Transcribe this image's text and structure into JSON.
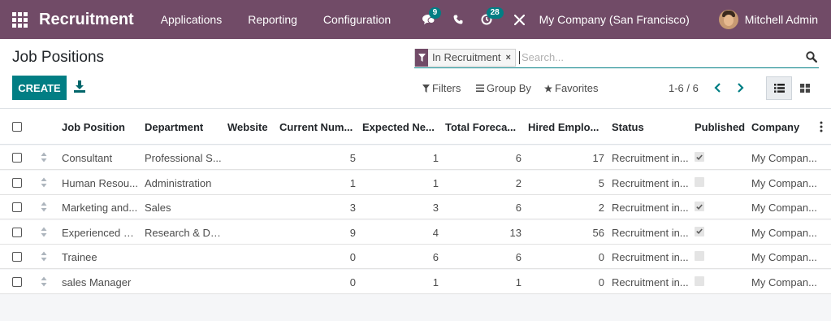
{
  "navbar": {
    "app_name": "Recruitment",
    "menu": [
      "Applications",
      "Reporting",
      "Configuration"
    ],
    "messages_badge": "9",
    "activities_badge": "28",
    "company": "My Company (San Francisco)",
    "user": "Mitchell Admin",
    "brand_color": "#714b67"
  },
  "control_panel": {
    "title": "Job Positions",
    "create_label": "CREATE",
    "search": {
      "facet": "In Recruitment",
      "placeholder": "Search..."
    },
    "filters_label": "Filters",
    "group_by_label": "Group By",
    "favorites_label": "Favorites",
    "pager": "1-6 / 6",
    "accent_color": "#017e84"
  },
  "table": {
    "columns": [
      "Job Position",
      "Department",
      "Website",
      "Current Num...",
      "Expected Ne...",
      "Total Foreca...",
      "Hired Emplo...",
      "Status",
      "Published",
      "Company"
    ],
    "rows": [
      {
        "job": "Consultant",
        "department": "Professional S...",
        "website": "",
        "current": "5",
        "expected": "1",
        "forecast": "6",
        "hired": "17",
        "status": "Recruitment in...",
        "published": true,
        "company": "My Compan..."
      },
      {
        "job": "Human Resou...",
        "department": "Administration",
        "website": "",
        "current": "1",
        "expected": "1",
        "forecast": "2",
        "hired": "5",
        "status": "Recruitment in...",
        "published": false,
        "company": "My Compan..."
      },
      {
        "job": "Marketing and...",
        "department": "Sales",
        "website": "",
        "current": "3",
        "expected": "3",
        "forecast": "6",
        "hired": "2",
        "status": "Recruitment in...",
        "published": true,
        "company": "My Compan..."
      },
      {
        "job": "Experienced D...",
        "department": "Research & De...",
        "website": "",
        "current": "9",
        "expected": "4",
        "forecast": "13",
        "hired": "56",
        "status": "Recruitment in...",
        "published": true,
        "company": "My Compan..."
      },
      {
        "job": "Trainee",
        "department": "",
        "website": "",
        "current": "0",
        "expected": "6",
        "forecast": "6",
        "hired": "0",
        "status": "Recruitment in...",
        "published": false,
        "company": "My Compan..."
      },
      {
        "job": "sales Manager",
        "department": "",
        "website": "",
        "current": "0",
        "expected": "1",
        "forecast": "1",
        "hired": "0",
        "status": "Recruitment in...",
        "published": false,
        "company": "My Compan..."
      }
    ]
  },
  "icons": [
    "apps-grid-icon",
    "chat-icon",
    "phone-icon",
    "activity-clock-icon",
    "tools-icon",
    "download-icon",
    "filter-icon",
    "search-icon",
    "group-by-icon",
    "star-icon",
    "chevron-left-icon",
    "chevron-right-icon",
    "list-view-icon",
    "kanban-view-icon",
    "drag-handle-icon",
    "column-options-icon"
  ]
}
